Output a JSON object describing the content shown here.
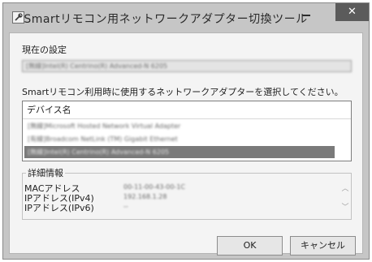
{
  "window": {
    "title": "Smartリモコン用ネットワークアダプター切換ツール",
    "close_glyph": "✕",
    "app_icon": "wrench-icon"
  },
  "current": {
    "label": "現在の設定",
    "value": "[無線]Intel(R) Centrino(R) Advanced-N 6205"
  },
  "instruction": "Smartリモコン利用時に使用するネットワークアダプターを選択してください。",
  "device_list": {
    "header": "デバイス名",
    "items": [
      "[無線]Microsoft Hosted Network Virtual Adapter",
      "[有線]Broadcom NetLink (TM) Gigabit Ethernet",
      "[無線]Intel(R) Centrino(R) Advanced-N 6205"
    ],
    "selected_index": 2
  },
  "details": {
    "legend": "詳細情報",
    "rows": [
      {
        "key": "MACアドレス",
        "value": "00-11-00-43-00-1C"
      },
      {
        "key": "IPアドレス(IPv4)",
        "value": "192.168.1.28"
      },
      {
        "key": "IPアドレス(IPv6)",
        "value": "--"
      }
    ],
    "scroll_up_glyph": "︿",
    "scroll_down_glyph": "﹀"
  },
  "buttons": {
    "ok": "OK",
    "cancel": "キャンセル"
  }
}
